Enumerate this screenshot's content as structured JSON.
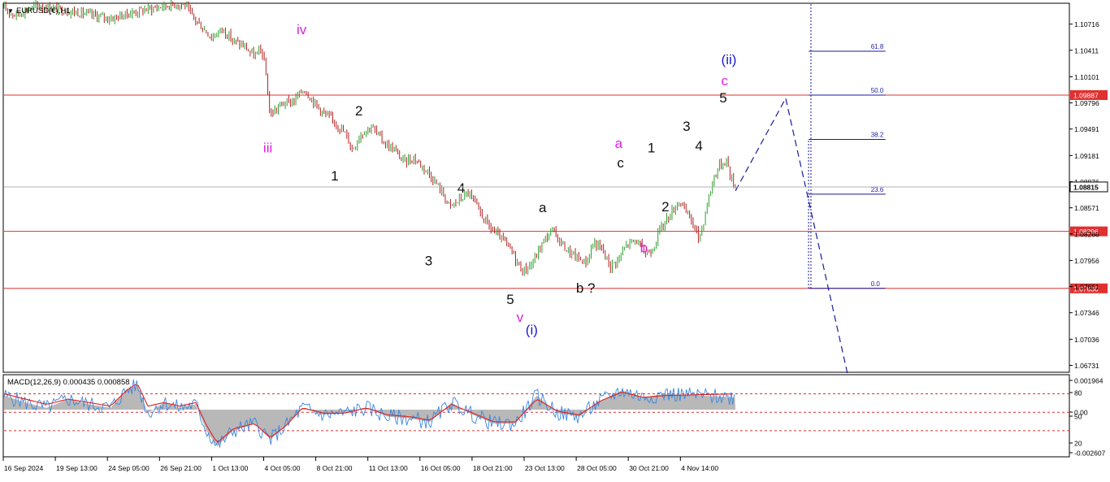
{
  "symbol_label": "EURUSD(€),H1",
  "colors": {
    "background": "#ffffff",
    "frame": "#000000",
    "bull_candle": "#2ca02c",
    "bear_candle": "#b22222",
    "price_level": "#e03030",
    "fib": "#1a1aa0",
    "projection": "#1a1aa0",
    "label_black": "#111111",
    "label_magenta": "#e020e0",
    "label_blue": "#1a1ad0",
    "macd_hist": "#b8b8b8",
    "macd_line": "#3a86e0",
    "signal_line": "#e02020",
    "current_price_fill": "#ffffff",
    "level_tag_fill": "#e03030"
  },
  "chart_data": [
    {
      "type": "candlestick",
      "title": "EURUSD(€),H1",
      "ylim": [
        1.0666,
        1.1095
      ],
      "y_ticks": [
        "1.10716",
        "1.10411",
        "1.10101",
        "1.09796",
        "1.09491",
        "1.09181",
        "1.08876",
        "1.08571",
        "1.08266",
        "1.07956",
        "1.07651",
        "1.07346",
        "1.07036",
        "1.06731"
      ],
      "x_ticks": [
        "16 Sep 2024",
        "19 Sep 13:00",
        "24 Sep 05:00",
        "26 Sep 21:00",
        "1 Oct 13:00",
        "4 Oct 05:00",
        "8 Oct 21:00",
        "11 Oct 13:00",
        "16 Oct 05:00",
        "18 Oct 21:00",
        "23 Oct 13:00",
        "28 Oct 05:00",
        "30 Oct 21:00",
        "4 Nov 14:00"
      ],
      "current_price": "1.08815",
      "price_path": [
        [
          0,
          1.109
        ],
        [
          0.01,
          1.1082
        ],
        [
          0.03,
          1.1093
        ],
        [
          0.05,
          1.1089
        ],
        [
          0.07,
          1.1085
        ],
        [
          0.1,
          1.1078
        ],
        [
          0.13,
          1.1088
        ],
        [
          0.16,
          1.1095
        ],
        [
          0.17,
          1.1094
        ],
        [
          0.175,
          1.1083
        ],
        [
          0.185,
          1.1069
        ],
        [
          0.195,
          1.1056
        ],
        [
          0.205,
          1.1066
        ],
        [
          0.215,
          1.1052
        ],
        [
          0.225,
          1.1046
        ],
        [
          0.235,
          1.1034
        ],
        [
          0.242,
          1.1042
        ],
        [
          0.2456,
          1.1015
        ],
        [
          0.2496,
          1.0965
        ],
        [
          0.26,
          1.0978
        ],
        [
          0.272,
          1.0982
        ],
        [
          0.2814,
          1.0996
        ],
        [
          0.29,
          1.0982
        ],
        [
          0.3,
          1.0967
        ],
        [
          0.31,
          1.0958
        ],
        [
          0.3207,
          1.0943
        ],
        [
          0.327,
          1.0925
        ],
        [
          0.335,
          1.0944
        ],
        [
          0.345,
          1.0952
        ],
        [
          0.357,
          1.0933
        ],
        [
          0.367,
          1.0924
        ],
        [
          0.375,
          1.0911
        ],
        [
          0.385,
          1.0915
        ],
        [
          0.398,
          1.0899
        ],
        [
          0.41,
          1.0878
        ],
        [
          0.4188,
          1.0858
        ],
        [
          0.43,
          1.0869
        ],
        [
          0.4358,
          1.0875
        ],
        [
          0.4408,
          1.0864
        ],
        [
          0.448,
          1.0849
        ],
        [
          0.456,
          1.0834
        ],
        [
          0.466,
          1.0822
        ],
        [
          0.472,
          1.0814
        ],
        [
          0.4789,
          1.0801
        ],
        [
          0.4828,
          1.0791
        ],
        [
          0.4869,
          1.0783
        ],
        [
          0.496,
          1.0792
        ],
        [
          0.506,
          1.0818
        ],
        [
          0.515,
          1.0831
        ],
        [
          0.5113,
          1.0839
        ],
        [
          0.52,
          1.0821
        ],
        [
          0.5296,
          1.0806
        ],
        [
          0.5376,
          1.0799
        ],
        [
          0.5466,
          1.0793
        ],
        [
          0.5535,
          1.0817
        ],
        [
          0.5609,
          1.0809
        ],
        [
          0.5693,
          1.0789
        ],
        [
          0.5773,
          1.0798
        ],
        [
          0.5848,
          1.0815
        ],
        [
          0.5936,
          1.0819
        ],
        [
          0.6024,
          1.0803
        ],
        [
          0.6093,
          1.0811
        ],
        [
          0.6158,
          1.0832
        ],
        [
          0.626,
          1.0851
        ],
        [
          0.6345,
          1.0866
        ],
        [
          0.6378,
          1.0856
        ],
        [
          0.6453,
          1.0843
        ],
        [
          0.6518,
          1.0822
        ],
        [
          0.6548,
          1.0831
        ],
        [
          0.6595,
          1.0859
        ],
        [
          0.6666,
          1.0894
        ],
        [
          0.6713,
          1.0906
        ],
        [
          0.6786,
          1.0913
        ],
        [
          0.6817,
          1.0893
        ],
        [
          0.6866,
          1.0882
        ]
      ],
      "price_levels": [
        {
          "value": 1.09887,
          "label": "1.09887"
        },
        {
          "value": 1.08296,
          "label": "1.08296"
        },
        {
          "value": 1.0763,
          "label": "1.07630"
        }
      ],
      "fibonacci": {
        "levels": [
          {
            "label": "61.8",
            "value": 1.104
          },
          {
            "label": "50.0",
            "value": 1.09887
          },
          {
            "label": "38.2",
            "value": 1.0937
          },
          {
            "label": "23.6",
            "value": 1.0873
          },
          {
            "label": "0.0",
            "value": 1.0763
          }
        ]
      },
      "projection_path": [
        [
          0.6866,
          1.0877
        ],
        [
          0.7337,
          1.0985
        ],
        [
          0.7918,
          1.0663
        ]
      ],
      "wave_labels": [
        {
          "text": "iv",
          "x": 0.2793,
          "y": 1.106,
          "color": "magenta"
        },
        {
          "text": "iii",
          "x": 0.2476,
          "y": 1.0922,
          "color": "magenta"
        },
        {
          "text": "2",
          "x": 0.3331,
          "y": 1.0965,
          "color": "black"
        },
        {
          "text": "1",
          "x": 0.3104,
          "y": 1.0889,
          "color": "black"
        },
        {
          "text": "4",
          "x": 0.4291,
          "y": 1.0875,
          "color": "black"
        },
        {
          "text": "3",
          "x": 0.3985,
          "y": 1.079,
          "color": "black"
        },
        {
          "text": "5",
          "x": 0.4752,
          "y": 1.0745,
          "color": "black"
        },
        {
          "text": "v",
          "x": 0.4843,
          "y": 1.0724,
          "color": "magenta"
        },
        {
          "text": "(i)",
          "x": 0.4953,
          "y": 1.0709,
          "color": "blue"
        },
        {
          "text": "a",
          "x": 0.5055,
          "y": 1.0852,
          "color": "black"
        },
        {
          "text": "b ?",
          "x": 0.5459,
          "y": 1.0758,
          "color": "black"
        },
        {
          "text": "c",
          "x": 0.5787,
          "y": 1.0904,
          "color": "black"
        },
        {
          "text": "a",
          "x": 0.5769,
          "y": 1.0927,
          "color": "magenta"
        },
        {
          "text": "b",
          "x": 0.6006,
          "y": 1.0805,
          "color": "magenta"
        },
        {
          "text": "1",
          "x": 0.6076,
          "y": 1.0922,
          "color": "black"
        },
        {
          "text": "2",
          "x": 0.6208,
          "y": 1.0853,
          "color": "black"
        },
        {
          "text": "3",
          "x": 0.6406,
          "y": 1.0947,
          "color": "black"
        },
        {
          "text": "4",
          "x": 0.6523,
          "y": 1.0924,
          "color": "black"
        },
        {
          "text": "5",
          "x": 0.675,
          "y": 1.098,
          "color": "black"
        },
        {
          "text": "c",
          "x": 0.6764,
          "y": 1.1,
          "color": "magenta"
        },
        {
          "text": "(ii)",
          "x": 0.6804,
          "y": 1.1025,
          "color": "blue"
        }
      ]
    },
    {
      "type": "area",
      "title": "MACD(12,26,9) 0.000435 0.000858",
      "ylim": [
        -0.0026,
        0.0019
      ],
      "y_ticks": [
        "0.001964",
        "80",
        "0.00",
        "50",
        "20",
        "-0.002607"
      ],
      "series": [
        {
          "name": "MACD",
          "style": "histogram",
          "points": [
            [
              0,
              0.0008
            ],
            [
              0.02,
              0.0004
            ],
            [
              0.04,
              0.0001
            ],
            [
              0.06,
              0.0006
            ],
            [
              0.08,
              0.0003
            ],
            [
              0.1,
              0.0001
            ],
            [
              0.115,
              0.0011
            ],
            [
              0.125,
              0.0014
            ],
            [
              0.135,
              -0.0002
            ],
            [
              0.15,
              0.0004
            ],
            [
              0.165,
              0.0001
            ],
            [
              0.18,
              0.0003
            ],
            [
              0.19,
              -0.0012
            ],
            [
              0.2,
              -0.0021
            ],
            [
              0.215,
              -0.0012
            ],
            [
              0.235,
              -0.0008
            ],
            [
              0.25,
              -0.0017
            ],
            [
              0.265,
              -0.0009
            ],
            [
              0.28,
              0.0001
            ],
            [
              0.3,
              -0.0003
            ],
            [
              0.32,
              -0.0002
            ],
            [
              0.34,
              0.0001
            ],
            [
              0.36,
              -0.0004
            ],
            [
              0.38,
              -0.0005
            ],
            [
              0.4,
              -0.0007
            ],
            [
              0.42,
              0.0004
            ],
            [
              0.44,
              -0.0003
            ],
            [
              0.46,
              -0.0008
            ],
            [
              0.48,
              -0.0008
            ],
            [
              0.5,
              0.0008
            ],
            [
              0.52,
              -0.0002
            ],
            [
              0.54,
              -0.0004
            ],
            [
              0.56,
              0.0005
            ],
            [
              0.58,
              0.0011
            ],
            [
              0.6,
              0.0007
            ],
            [
              0.62,
              0.0009
            ],
            [
              0.6866,
              0.0007
            ]
          ]
        },
        {
          "name": "Signal",
          "style": "line",
          "points": [
            [
              0,
              0.0009
            ],
            [
              0.02,
              0.0006
            ],
            [
              0.04,
              0.0003
            ],
            [
              0.06,
              0.0006
            ],
            [
              0.08,
              0.0004
            ],
            [
              0.1,
              0.0002
            ],
            [
              0.115,
              0.0011
            ],
            [
              0.125,
              0.0015
            ],
            [
              0.135,
              0.0002
            ],
            [
              0.15,
              0.0004
            ],
            [
              0.165,
              0.0002
            ],
            [
              0.18,
              0.0004
            ],
            [
              0.19,
              -0.0009
            ],
            [
              0.2,
              -0.0019
            ],
            [
              0.215,
              -0.0011
            ],
            [
              0.235,
              -0.0008
            ],
            [
              0.25,
              -0.0016
            ],
            [
              0.265,
              -0.0009
            ],
            [
              0.28,
              0.0001
            ],
            [
              0.3,
              -0.0002
            ],
            [
              0.32,
              -0.0002
            ],
            [
              0.34,
              0.0001
            ],
            [
              0.36,
              -0.0003
            ],
            [
              0.38,
              -0.0004
            ],
            [
              0.4,
              -0.0006
            ],
            [
              0.42,
              0.0003
            ],
            [
              0.44,
              -0.0002
            ],
            [
              0.46,
              -0.0007
            ],
            [
              0.48,
              -0.0007
            ],
            [
              0.5,
              0.0006
            ],
            [
              0.52,
              -0.0001
            ],
            [
              0.54,
              -0.0003
            ],
            [
              0.56,
              0.0005
            ],
            [
              0.58,
              0.001
            ],
            [
              0.6,
              0.0007
            ],
            [
              0.62,
              0.0008
            ],
            [
              0.6866,
              0.0009
            ]
          ]
        }
      ],
      "reference_levels": [
        0.0009,
        -0.00015,
        -0.0012
      ]
    }
  ]
}
